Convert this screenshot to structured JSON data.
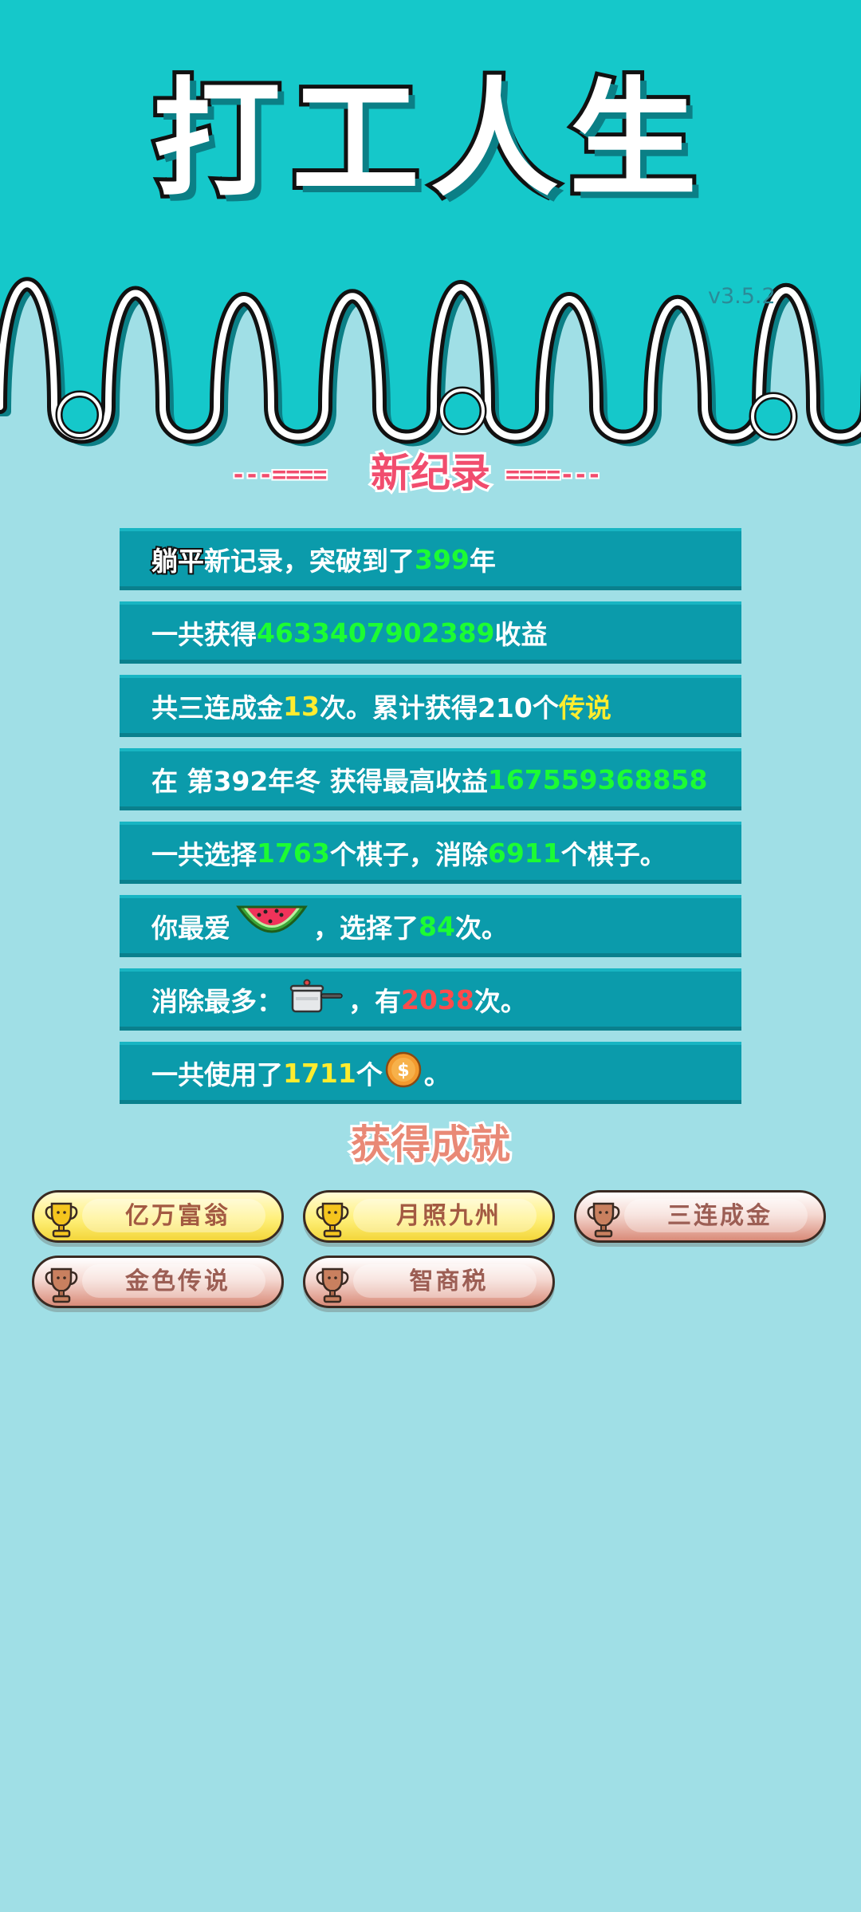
{
  "game": {
    "title": "打工人生",
    "version": "v3.5.2"
  },
  "record": {
    "heading": "新纪录",
    "dash_left": "---====",
    "dash_right": "====---",
    "rows": [
      {
        "nickname": "躺平",
        "pre": "新记录，突破到了",
        "value": "399",
        "post": "年"
      },
      {
        "pre": "一共获得",
        "value": "4633407902389",
        "post": "收益"
      },
      {
        "pre": "共三连成金",
        "value": "13",
        "mid": "次。累计获得210个",
        "value2": "传说"
      },
      {
        "pre": "在 第392年冬 获得最高收益",
        "value": "167559368858"
      },
      {
        "pre": "一共选择",
        "value": "1763",
        "mid": "个棋子，消除",
        "value2": "6911",
        "post": "个棋子。"
      },
      {
        "pre": "你最爱",
        "icon": "watermelon-icon",
        "mid": "，选择了",
        "value": "84",
        "post": "次。"
      },
      {
        "pre": "消除最多：",
        "icon": "cooking-pot-icon",
        "mid": "，有",
        "value": "2038",
        "post": "次。"
      },
      {
        "pre": "一共使用了",
        "value": "1711",
        "mid": "个",
        "icon": "coin-icon",
        "post": "。"
      }
    ]
  },
  "achievements": {
    "heading": "获得成就",
    "items": [
      {
        "label": "亿万富翁",
        "tier": "gold",
        "icon": "trophy-icon"
      },
      {
        "label": "月照九州",
        "tier": "gold",
        "icon": "trophy-icon"
      },
      {
        "label": "三连成金",
        "tier": "bronze",
        "icon": "trophy-icon"
      },
      {
        "label": "金色传说",
        "tier": "bronze",
        "icon": "trophy-icon"
      },
      {
        "label": "智商税",
        "tier": "bronze",
        "icon": "trophy-icon"
      }
    ]
  },
  "colors": {
    "top_background": "#15c8ca",
    "background": "#a0dfe6",
    "row_background": "#0b9bab",
    "value_green": "#1cfc33",
    "value_yellow": "#ffec2e",
    "value_red": "#ff4b4b",
    "heading_pink": "#f14d6e"
  }
}
